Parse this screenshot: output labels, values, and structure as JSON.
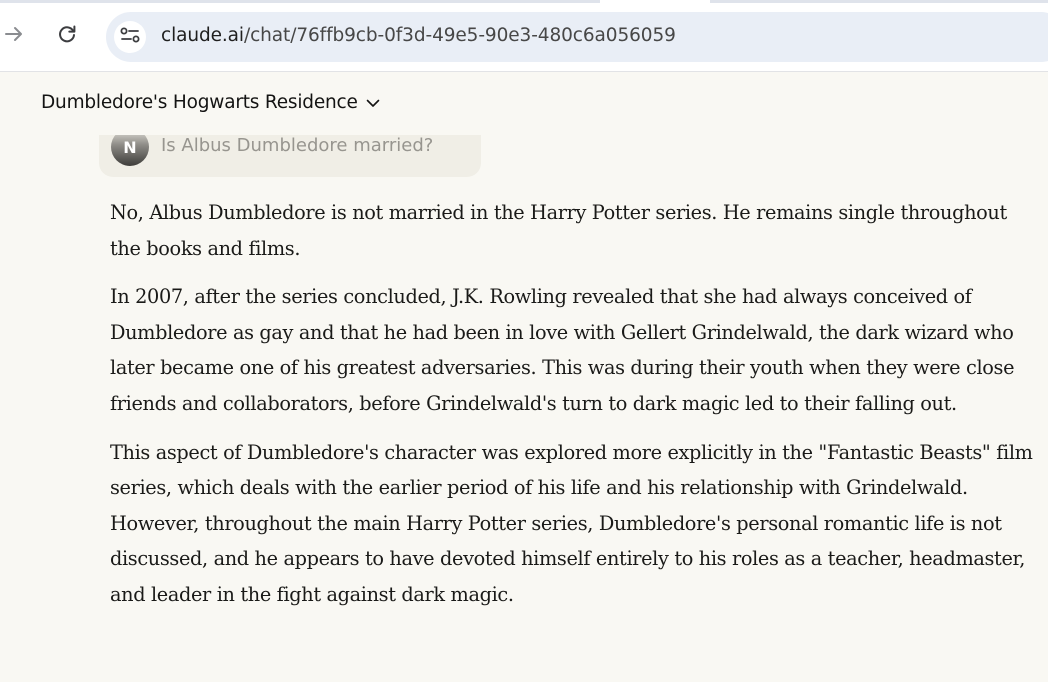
{
  "browser": {
    "url_host": "claude.ai",
    "url_path": "/chat/76ffb9cb-0f3d-49e5-90e3-480c6a056059"
  },
  "chat": {
    "title": "Dumbledore's Hogwarts Residence",
    "user_avatar_initial": "N",
    "user_message": "Is Albus Dumbledore married?",
    "response_paragraphs": [
      "No, Albus Dumbledore is not married in the Harry Potter series. He remains single throughout the books and films.",
      "In 2007, after the series concluded, J.K. Rowling revealed that she had always conceived of Dumbledore as gay and that he had been in love with Gellert Grindelwald, the dark wizard who later became one of his greatest adversaries. This was during their youth when they were close friends and collaborators, before Grindelwald's turn to dark magic led to their falling out.",
      "This aspect of Dumbledore's character was explored more explicitly in the \"Fantastic Beasts\" film series, which deals with the earlier period of his life and his relationship with Grindelwald. However, throughout the main Harry Potter series, Dumbledore's personal romantic life is not discussed, and he appears to have devoted himself entirely to his roles as a teacher, headmaster, and leader in the fight against dark magic."
    ]
  },
  "icons": {
    "back": "arrow-right-icon",
    "reload": "reload-icon",
    "site_info": "tune-icon",
    "title_dropdown": "chevron-down-icon"
  },
  "colors": {
    "page_background": "#f9f8f3",
    "user_bubble": "#f0eee6",
    "omnibox": "#e9eef6"
  }
}
